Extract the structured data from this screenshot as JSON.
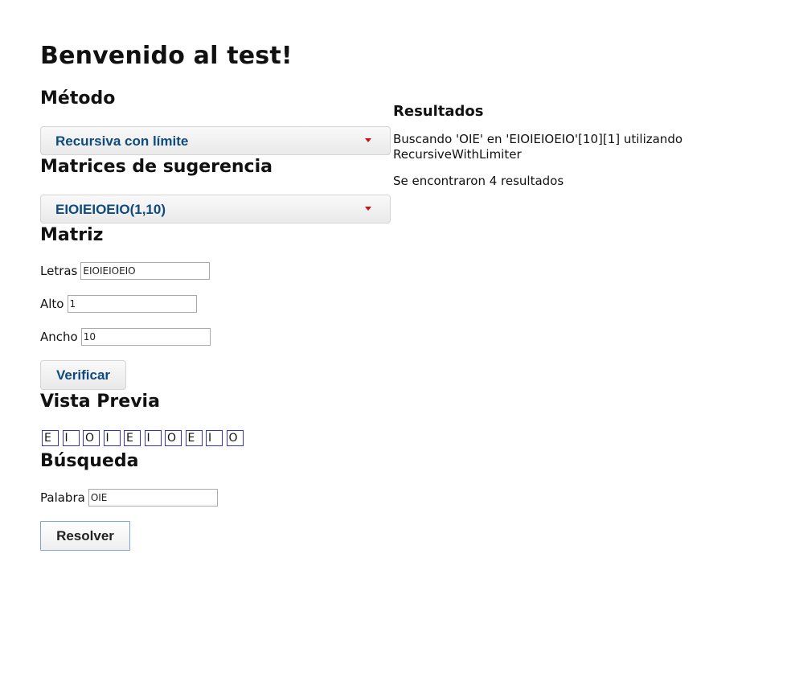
{
  "page": {
    "title": "Benvenido al test!"
  },
  "method": {
    "heading": "Método",
    "selected": "Recursiva con límite"
  },
  "suggestions": {
    "heading": "Matrices de sugerencia",
    "selected": "EIOIEIOEIO(1,10)"
  },
  "matrix": {
    "heading": "Matriz",
    "letters_label": "Letras",
    "letters_value": "EIOIEIOEIO",
    "height_label": "Alto",
    "height_value": "1",
    "width_label": "Ancho",
    "width_value": "10",
    "verify_label": "Verificar"
  },
  "preview": {
    "heading": "Vista Previa",
    "cells": [
      "E",
      "I",
      "O",
      "I",
      "E",
      "I",
      "O",
      "E",
      "I",
      "O"
    ]
  },
  "search": {
    "heading": "Búsqueda",
    "word_label": "Palabra",
    "word_value": "OIE",
    "solve_label": "Resolver"
  },
  "results": {
    "heading": "Resultados",
    "line1": "Buscando 'OIE' en 'EIOIEIOEIO'[10][1] utilizando RecursiveWithLimiter",
    "line2": "Se encontraron 4 resultados"
  },
  "colors": {
    "accent_text": "#0f4a7f",
    "caret": "#cc1111",
    "cell_border": "#3333cc"
  },
  "icons": {
    "dropdown_caret": "caret-down-icon"
  }
}
